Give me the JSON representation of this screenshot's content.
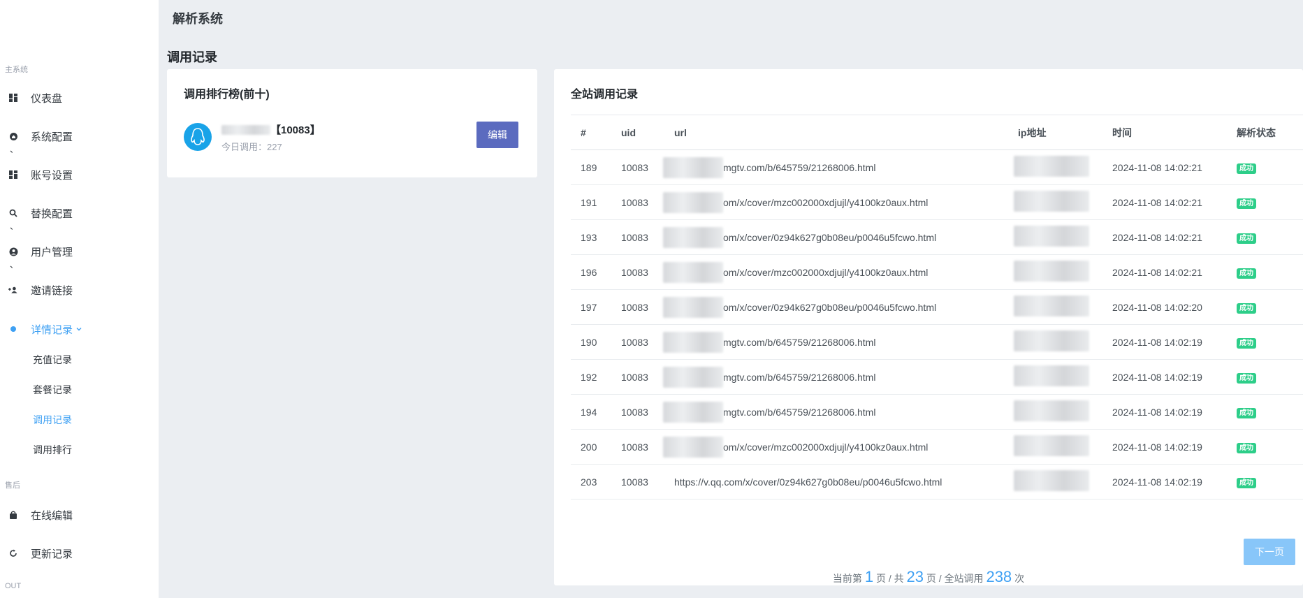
{
  "app": {
    "title": "解析系统"
  },
  "sidebar": {
    "section_main": "主系统",
    "items": [
      {
        "label": "仪表盘",
        "icon": "dashboard-icon"
      },
      {
        "label": "系统配置",
        "icon": "home-icon"
      },
      {
        "label": "账号设置",
        "icon": "grid-icon"
      },
      {
        "label": "替换配置",
        "icon": "search-icon"
      },
      {
        "label": "用户管理",
        "icon": "user-circle-icon"
      },
      {
        "label": "邀请链接",
        "icon": "user-group-icon"
      },
      {
        "label": "详情记录",
        "icon": "dot-icon"
      }
    ],
    "subitems": [
      "充值记录",
      "套餐记录",
      "调用记录",
      "调用排行"
    ],
    "section_after": "售后",
    "after_items": [
      {
        "label": "在线编辑",
        "icon": "bag-icon"
      },
      {
        "label": "更新记录",
        "icon": "refresh-icon"
      }
    ],
    "section_out": "OUT",
    "tick": "、"
  },
  "page": {
    "title": "调用记录"
  },
  "ranking": {
    "title": "调用排行榜(前十)",
    "uid": "【10083】",
    "today": "今日调用：227",
    "edit_label": "编辑"
  },
  "records": {
    "title": "全站调用记录",
    "columns": [
      "#",
      "uid",
      "url",
      "ip地址",
      "时间",
      "解析状态"
    ],
    "rows": [
      {
        "id": "189",
        "uid": "10083",
        "url": "mgtv.com/b/645759/21268006.html",
        "time": "2024-11-08 14:02:21",
        "status": "成功"
      },
      {
        "id": "191",
        "uid": "10083",
        "url": "om/x/cover/mzc002000xdjujl/y4100kz0aux.html",
        "time": "2024-11-08 14:02:21",
        "status": "成功"
      },
      {
        "id": "193",
        "uid": "10083",
        "url": "om/x/cover/0z94k627g0b08eu/p0046u5fcwo.html",
        "time": "2024-11-08 14:02:21",
        "status": "成功"
      },
      {
        "id": "196",
        "uid": "10083",
        "url": "om/x/cover/mzc002000xdjujl/y4100kz0aux.html",
        "time": "2024-11-08 14:02:21",
        "status": "成功"
      },
      {
        "id": "197",
        "uid": "10083",
        "url": "om/x/cover/0z94k627g0b08eu/p0046u5fcwo.html",
        "time": "2024-11-08 14:02:20",
        "status": "成功"
      },
      {
        "id": "190",
        "uid": "10083",
        "url": "mgtv.com/b/645759/21268006.html",
        "time": "2024-11-08 14:02:19",
        "status": "成功"
      },
      {
        "id": "192",
        "uid": "10083",
        "url": "mgtv.com/b/645759/21268006.html",
        "time": "2024-11-08 14:02:19",
        "status": "成功"
      },
      {
        "id": "194",
        "uid": "10083",
        "url": "mgtv.com/b/645759/21268006.html",
        "time": "2024-11-08 14:02:19",
        "status": "成功"
      },
      {
        "id": "200",
        "uid": "10083",
        "url": "om/x/cover/mzc002000xdjujl/y4100kz0aux.html",
        "time": "2024-11-08 14:02:19",
        "status": "成功"
      },
      {
        "id": "203",
        "uid": "10083",
        "url": "https://v.qq.com/x/cover/0z94k627g0b08eu/p0046u5fcwo.html",
        "time": "2024-11-08 14:02:19",
        "status": "成功"
      }
    ]
  },
  "pager": {
    "prefix": "当前第",
    "page": "1",
    "page_unit": "页 / 共",
    "total_pages": "23",
    "mid": "页 / 全站调用",
    "total_calls": "238",
    "suffix": "次",
    "next_label": "下一页"
  },
  "colors": {
    "accent": "#3ea0f3",
    "edit_button": "#5b6bbf",
    "success": "#2dce89",
    "avatar": "#19a3e8"
  }
}
